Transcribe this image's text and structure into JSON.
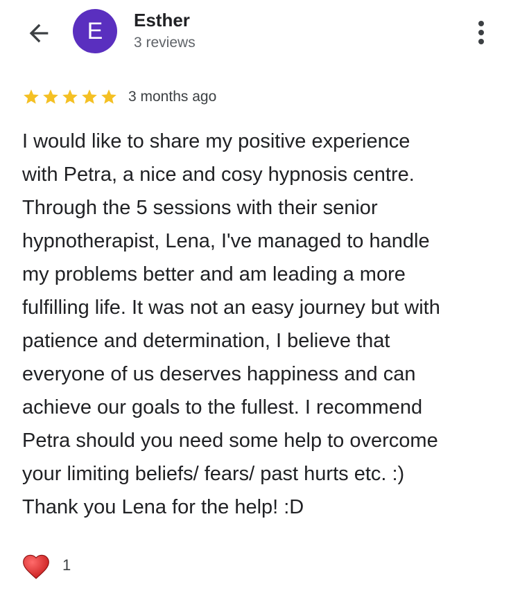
{
  "header": {
    "back_icon": "arrow-back-icon",
    "avatar": {
      "initial": "E",
      "color": "#5a2fbf"
    },
    "reviewer_name": "Esther",
    "review_count": "3 reviews",
    "more_icon": "more-vertical-icon"
  },
  "review": {
    "rating": 5,
    "max_rating": 5,
    "star_color": "#f4c024",
    "date": "3 months ago",
    "text": "I would like to share my positive experience\nwith Petra, a nice and cosy hypnosis centre.\nThrough the 5 sessions with their senior\nhypnotherapist, Lena, I've managed to handle\nmy problems better and am leading a more\nfulfilling life. It was not an easy journey but with\npatience and determination, I believe that\neveryone of us deserves happiness and can\nachieve our goals to the fullest. I recommend\nPetra should you need some help to overcome\nyour limiting beliefs/ fears/ past hurts etc. :)\nThank you Lena for the help! :D"
  },
  "reactions": {
    "icon": "heart-icon",
    "heart_color": "#e32b2b",
    "count": "1"
  }
}
